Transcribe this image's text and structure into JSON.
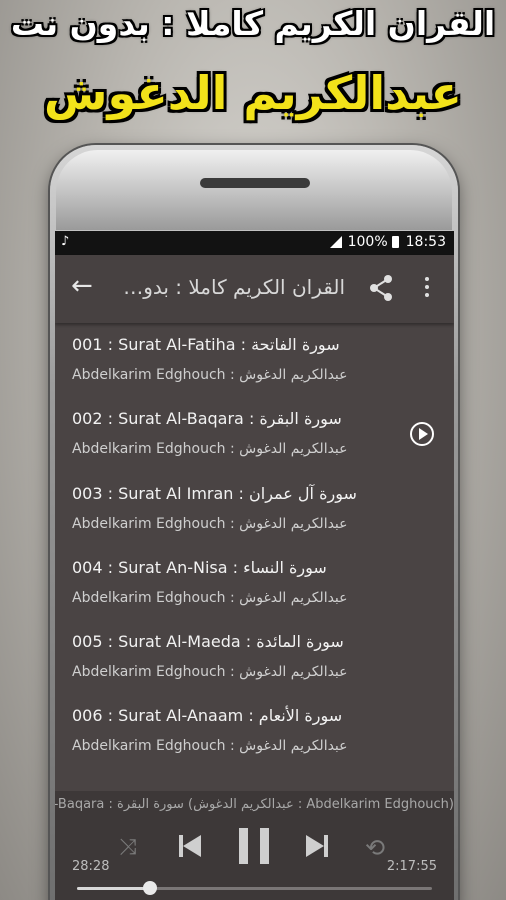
{
  "banner": {
    "line1": "القران الكريم كاملا : بدون نت",
    "line2": "عبدالكريم الدغوش"
  },
  "status_bar": {
    "battery": "100%",
    "time": "18:53",
    "music_icon": "music-note-icon"
  },
  "app_bar": {
    "title": "القران الكريم كاملا : بدون نت",
    "back_icon": "arrow-back-icon",
    "share_icon": "share-icon",
    "menu_icon": "more-vert-icon"
  },
  "tracks": [
    {
      "title": "001 : Surat Al-Fatiha : سورة الفاتحة",
      "subtitle": "Abdelkarim Edghouch : عبدالكريم الدغوش"
    },
    {
      "title": "002 : Surat Al-Baqara : سورة البقرة",
      "subtitle": "Abdelkarim Edghouch : عبدالكريم الدغوش",
      "playing": true
    },
    {
      "title": "003 : Surat Al Imran : سورة آل عمران",
      "subtitle": "Abdelkarim Edghouch : عبدالكريم الدغوش"
    },
    {
      "title": "004 : Surat An-Nisa : سورة النساء",
      "subtitle": "Abdelkarim Edghouch : عبدالكريم الدغوش"
    },
    {
      "title": "005 : Surat Al-Maeda : سورة المائدة",
      "subtitle": "Abdelkarim Edghouch : عبدالكريم الدغوش"
    },
    {
      "title": "006 :  Surat Al-Anaam : سورة الأنعام",
      "subtitle": "Abdelkarim Edghouch : عبدالكريم الدغوش"
    }
  ],
  "player": {
    "now_playing": "(Abdelkarim Edghouch : عبدالكريم الدغوش) سورة البقرة : Surat Al-Baqara",
    "elapsed": "28:28",
    "duration": "2:17:55",
    "progress_fraction": 0.206
  },
  "colors": {
    "banner_title": "#ffffff",
    "banner_name": "#f2e21a",
    "screen_bg": "#4a4444",
    "appbar_bg": "#474141",
    "player_bg": "#3d3838"
  }
}
